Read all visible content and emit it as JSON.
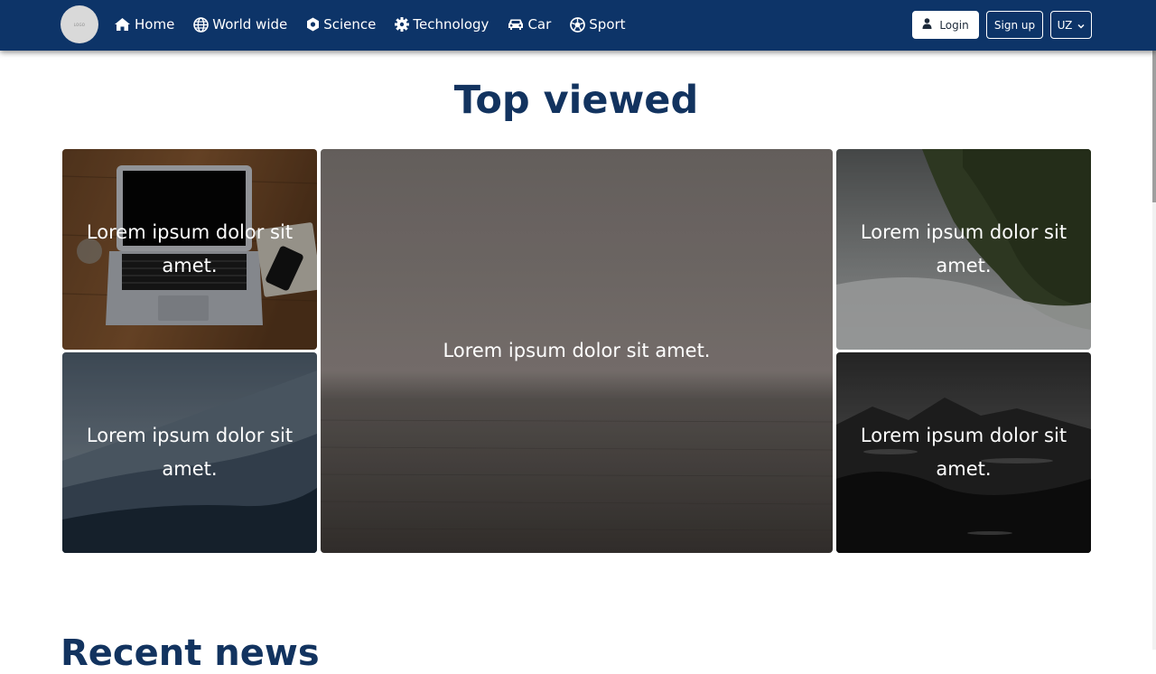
{
  "nav": {
    "logo_text": "LOGO",
    "links": [
      {
        "label": "Home",
        "icon": "home-icon"
      },
      {
        "label": "World wide",
        "icon": "globe-icon"
      },
      {
        "label": "Science",
        "icon": "atom-icon"
      },
      {
        "label": "Technology",
        "icon": "gear-icon"
      },
      {
        "label": "Car",
        "icon": "car-icon"
      },
      {
        "label": "Sport",
        "icon": "football-icon"
      }
    ],
    "login_label": "Login",
    "signup_label": "Sign up",
    "language": "UZ"
  },
  "top_viewed": {
    "title": "Top viewed",
    "cards": [
      {
        "text": "Lorem ipsum dolor sit amet.",
        "image": "laptop-on-desk"
      },
      {
        "text": "Lorem ipsum dolor sit amet.",
        "image": "misty-mountains"
      },
      {
        "text": "Lorem ipsum dolor sit amet.",
        "image": "foggy-sea"
      },
      {
        "text": "Lorem ipsum dolor sit amet.",
        "image": "misty-cliff"
      },
      {
        "text": "Lorem ipsum dolor sit amet.",
        "image": "rocky-shore"
      }
    ]
  },
  "recent_news": {
    "title": "Recent news"
  },
  "colors": {
    "navbar": "#0d3468",
    "heading": "#12335f"
  }
}
